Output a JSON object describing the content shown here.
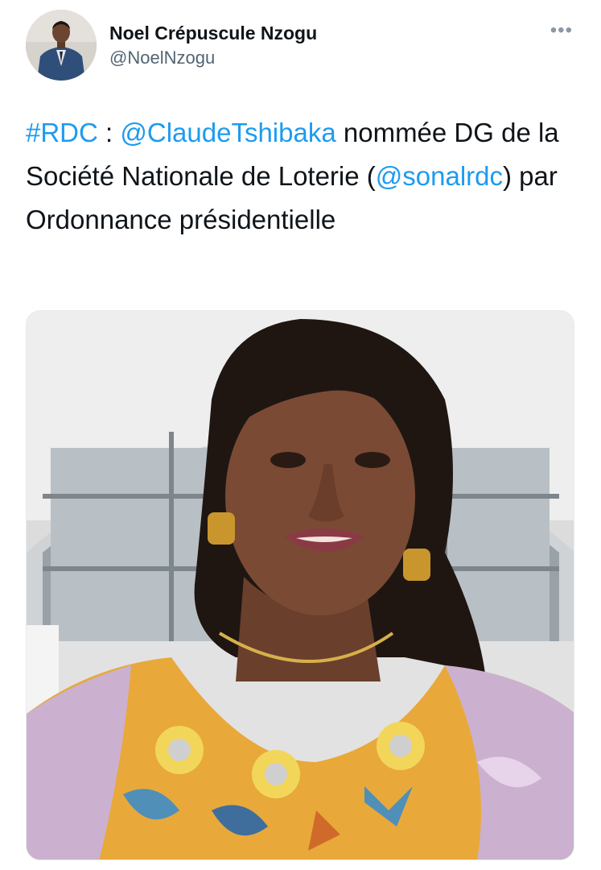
{
  "author": {
    "display_name": "Noel Crépuscule Nzogu",
    "handle": "@NoelNzogu",
    "avatar_icon": "user-avatar-photo"
  },
  "more_icon": "ellipsis-icon",
  "tweet": {
    "hashtag": "#RDC",
    "separator": " : ",
    "mention_1": "@ClaudeTshibaka",
    "text_1": " nommée DG de la Société Nationale de Loterie (",
    "mention_2": "@sonalrdc",
    "text_2": ") par Ordonnance présidentielle"
  },
  "media": {
    "type": "photo",
    "subject": "woman-portrait-photo"
  },
  "colors": {
    "link": "#1d9bf0",
    "text": "#0f1419",
    "secondary": "#536471"
  }
}
